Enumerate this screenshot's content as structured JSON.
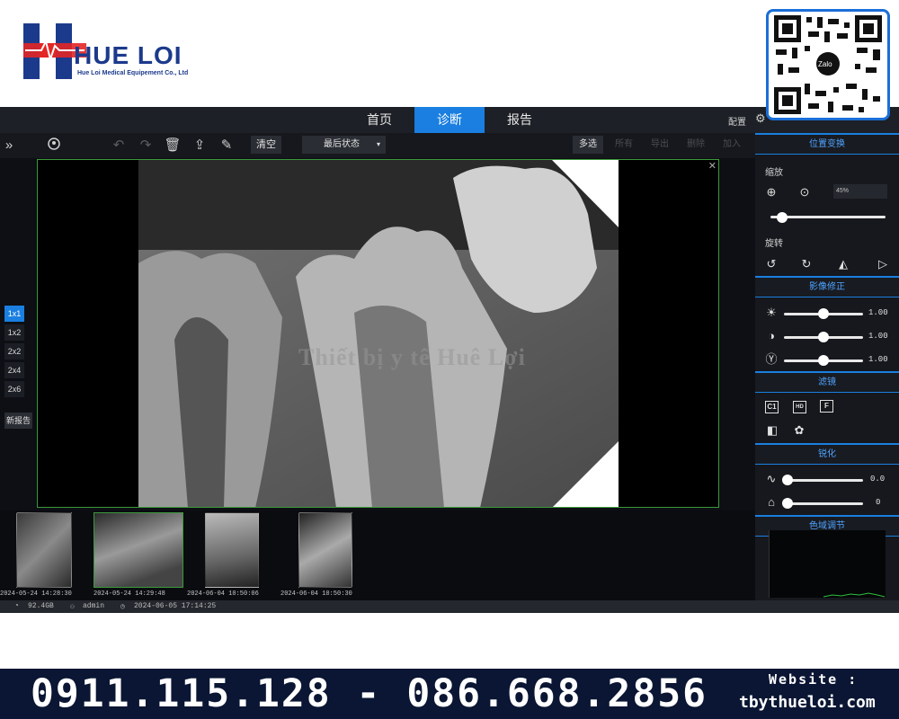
{
  "brand": {
    "name": "HUE LOI",
    "subtitle": "Hue Loi Medical Equipement Co., Ltd",
    "qr_label": "Zalo"
  },
  "nav": {
    "tabs": [
      "首页",
      "诊断",
      "报告"
    ],
    "active_tab": "诊断",
    "config_label": "配置"
  },
  "toolbar": {
    "clear_label": "清空",
    "status_select": "最后状态",
    "multi_label": "多选",
    "all_label": "所有",
    "export_label": "导出",
    "delete_label": "删除",
    "import_label": "加入"
  },
  "layouts": [
    "1x1",
    "1x2",
    "2x2",
    "2x4",
    "2x6"
  ],
  "active_layout": "1x1",
  "new_report_label": "新报告",
  "viewer": {
    "watermark": "Thiết bị y tế Huê Lợi"
  },
  "thumbnails": [
    {
      "timestamp": "2024-05-24 14:28:30"
    },
    {
      "timestamp": "2024-05-24 14:29:48"
    },
    {
      "timestamp": "2024-06-04 10:50:06"
    },
    {
      "timestamp": "2024-06-04 10:50:30"
    }
  ],
  "statusbar": {
    "disk": "92.4GB",
    "user": "admin",
    "datetime": "2024-06-05 17:14:25"
  },
  "panel": {
    "transform_header": "位置变换",
    "zoom_label": "缩放",
    "zoom_value": "45%",
    "zoom_slider": 0.1,
    "rotate_label": "旋转",
    "correction_header": "影像修正",
    "brightness_value": "1.00",
    "contrast_value": "1.00",
    "gamma_value": "1.00",
    "brightness_slider": 0.5,
    "contrast_slider": 0.5,
    "gamma_slider": 0.5,
    "filter_header": "滤镜",
    "filter_c1": "C1",
    "filter_hd": "HD",
    "filter_f": "F",
    "sharpen_header": "锐化",
    "sharpen_value": "0.0",
    "denoise_value": "0",
    "sharpen_slider": 0.0,
    "denoise_slider": 0.0,
    "colorrange_header": "色域调节"
  },
  "banner": {
    "phones": "0911.115.128 - 086.668.2856",
    "website_label": "Website :",
    "website_url": "tbythueloi.com"
  },
  "colors": {
    "accent": "#1a7fe0",
    "viewport_border": "#3a9a3a",
    "banner_bg": "#0a1633",
    "logo_red": "#e32626",
    "logo_blue": "#1c3a8c"
  }
}
